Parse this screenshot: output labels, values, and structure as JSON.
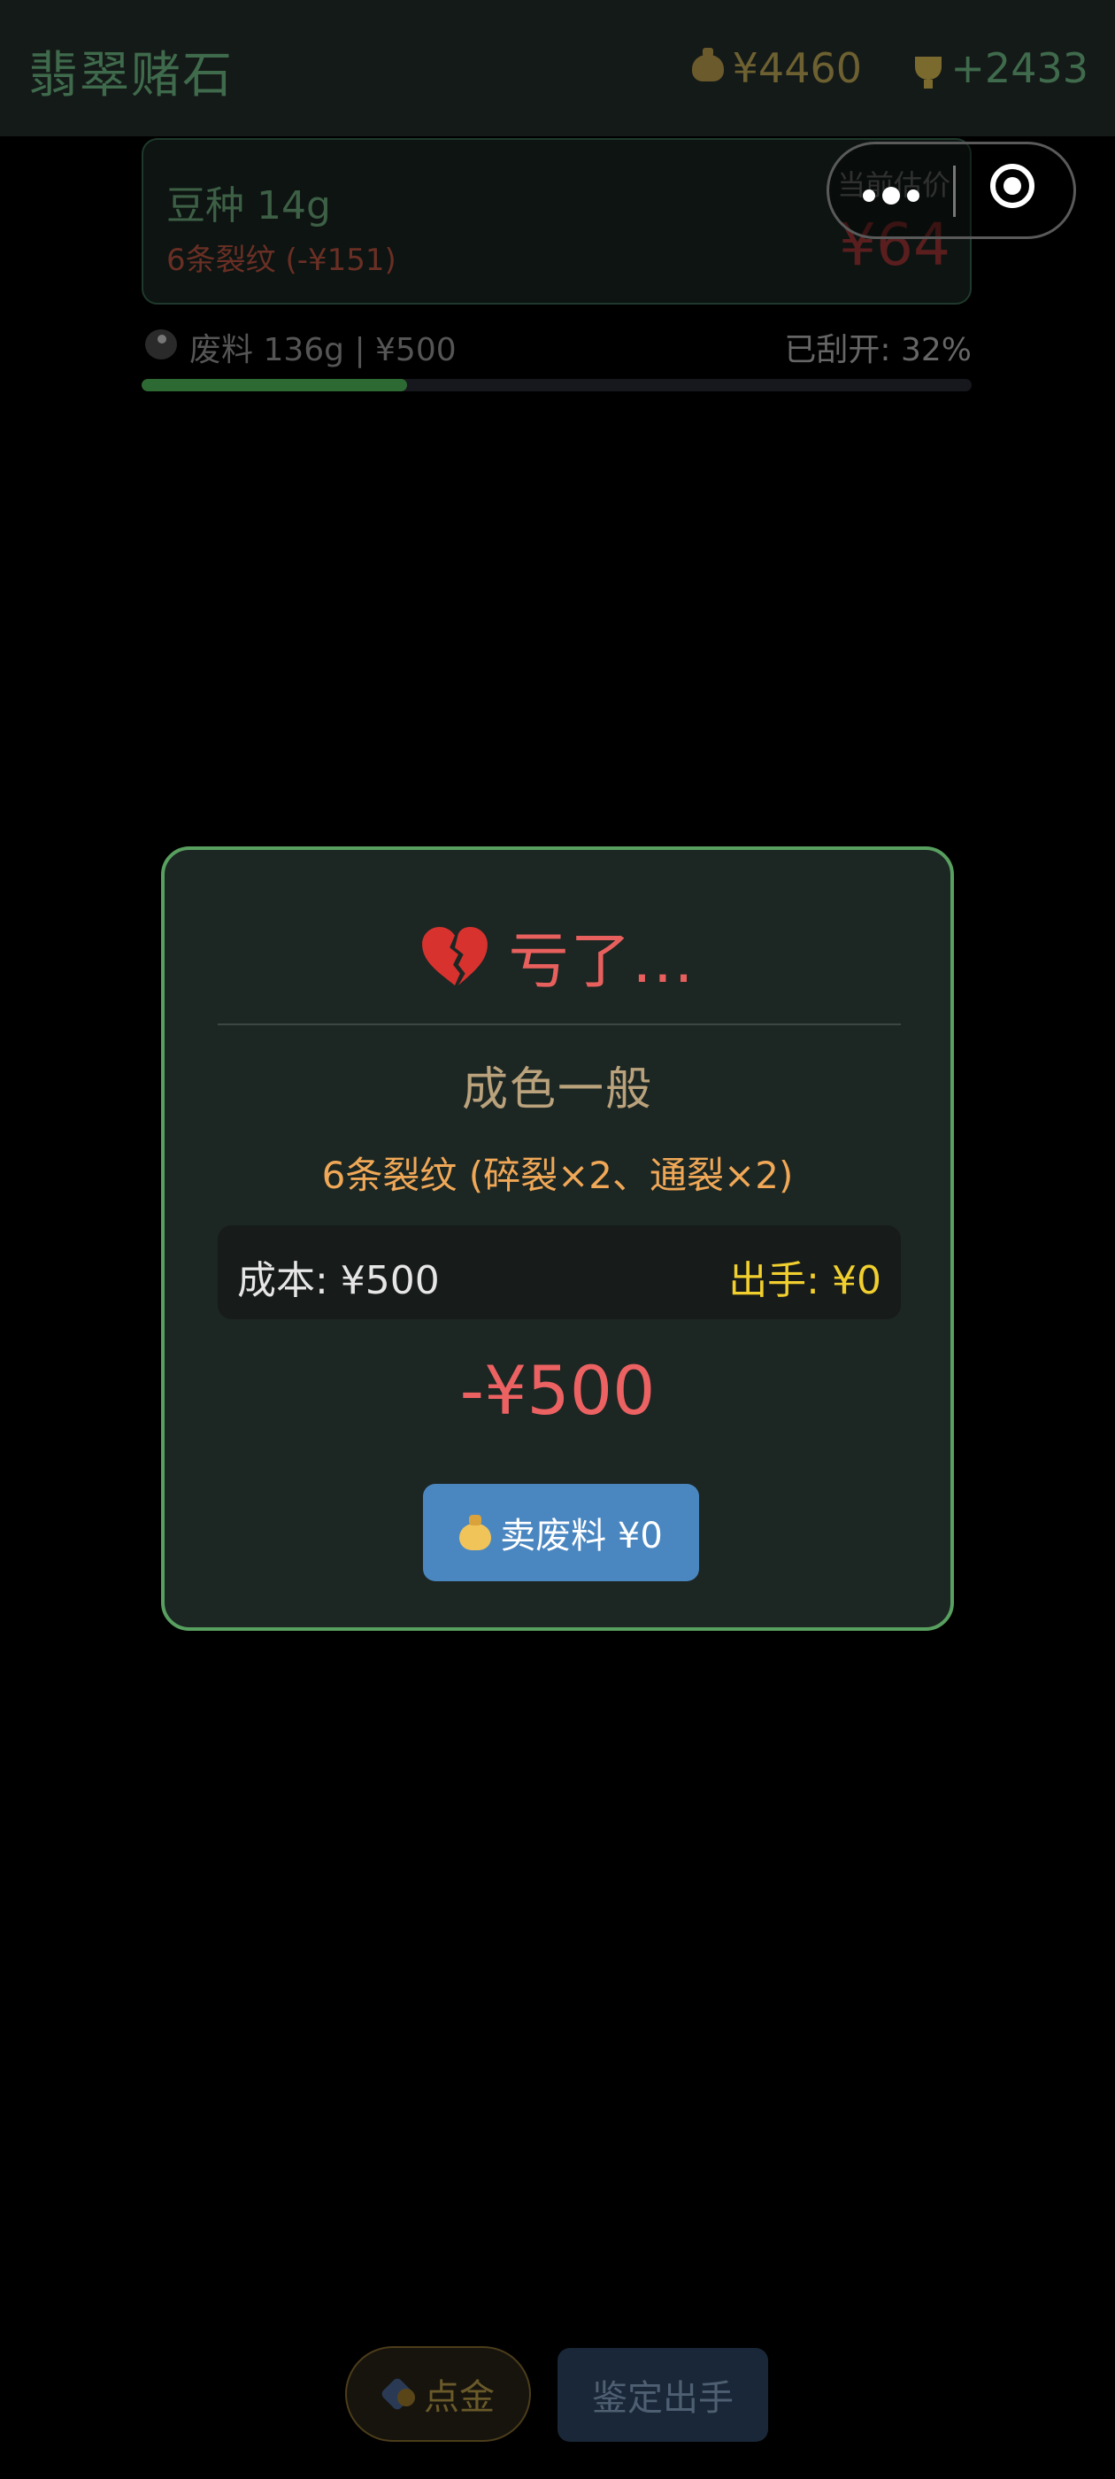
{
  "header": {
    "app_title": "翡翠赌石",
    "money": "¥4460",
    "score": "+2433"
  },
  "stone": {
    "name": "豆种 14g",
    "crack_summary": "6条裂纹 (-¥151)",
    "estimate_label": "当前估价",
    "estimate_value": "¥64"
  },
  "waste": {
    "info": "废料 136g | ¥500",
    "opened": "已刮开: 32%",
    "opened_fraction": 0.32
  },
  "modal": {
    "title": "亏了...",
    "quality": "成色一般",
    "crack_detail": "6条裂纹 (碎裂×2、通裂×2)",
    "cost": "成本: ¥500",
    "sell_price": "出手: ¥0",
    "loss": "-¥500",
    "sell_waste_button": "卖废料 ¥0"
  },
  "bottom_bar": {
    "gold_button": "点金",
    "appraise_button": "鉴定出手"
  },
  "colors": {
    "modal_border": "#58a05f",
    "loss_red": "#ec6262",
    "sell_yellow": "#f1cf2e",
    "button_blue": "#4a87c1"
  },
  "icons": [
    "money-bag-icon",
    "trophy-icon",
    "stone-icon",
    "broken-heart-icon",
    "more-dots-icon",
    "close-target-icon",
    "gold-touch-icon"
  ]
}
